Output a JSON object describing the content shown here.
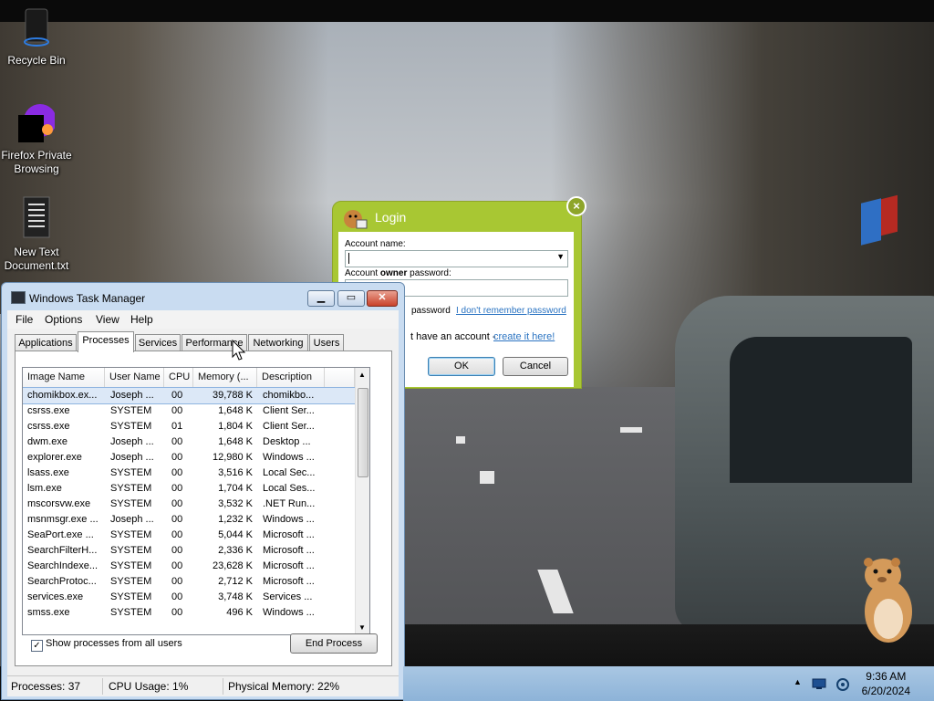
{
  "desktop": {
    "icons": [
      {
        "label": "Recycle Bin",
        "icon": "recycle-bin-icon"
      },
      {
        "label": "Firefox Private Browsing",
        "icon": "firefox-private-icon"
      },
      {
        "label": "New Text Document.txt",
        "icon": "text-document-icon"
      }
    ]
  },
  "login": {
    "title": "Login",
    "account_name_label": "Account name:",
    "account_name_value": "",
    "password_label_pre": "Account ",
    "password_label_bold": "owner",
    "password_label_post": " password:",
    "password_value": "",
    "remember_partial": "password",
    "forgot_link": "I don't remember password",
    "no_account_text": "t have an account - ",
    "create_link": "create it here!",
    "ok_label": "OK",
    "cancel_label": "Cancel"
  },
  "task_manager": {
    "title": "Windows Task Manager",
    "menu": [
      "File",
      "Options",
      "View",
      "Help"
    ],
    "tabs": [
      "Applications",
      "Processes",
      "Services",
      "Performance",
      "Networking",
      "Users"
    ],
    "active_tab": "Processes",
    "columns": [
      "Image Name",
      "User Name",
      "CPU",
      "Memory (...",
      "Description"
    ],
    "processes": [
      {
        "name": "chomikbox.ex...",
        "user": "Joseph ...",
        "cpu": "00",
        "mem": "39,788 K",
        "desc": "chomikbo..."
      },
      {
        "name": "csrss.exe",
        "user": "SYSTEM",
        "cpu": "00",
        "mem": "1,648 K",
        "desc": "Client Ser..."
      },
      {
        "name": "csrss.exe",
        "user": "SYSTEM",
        "cpu": "01",
        "mem": "1,804 K",
        "desc": "Client Ser..."
      },
      {
        "name": "dwm.exe",
        "user": "Joseph ...",
        "cpu": "00",
        "mem": "1,648 K",
        "desc": "Desktop ..."
      },
      {
        "name": "explorer.exe",
        "user": "Joseph ...",
        "cpu": "00",
        "mem": "12,980 K",
        "desc": "Windows ..."
      },
      {
        "name": "lsass.exe",
        "user": "SYSTEM",
        "cpu": "00",
        "mem": "3,516 K",
        "desc": "Local Sec..."
      },
      {
        "name": "lsm.exe",
        "user": "SYSTEM",
        "cpu": "00",
        "mem": "1,704 K",
        "desc": "Local Ses..."
      },
      {
        "name": "mscorsvw.exe",
        "user": "SYSTEM",
        "cpu": "00",
        "mem": "3,532 K",
        "desc": ".NET Run..."
      },
      {
        "name": "msnmsgr.exe ...",
        "user": "Joseph ...",
        "cpu": "00",
        "mem": "1,232 K",
        "desc": "Windows ..."
      },
      {
        "name": "SeaPort.exe ...",
        "user": "SYSTEM",
        "cpu": "00",
        "mem": "5,044 K",
        "desc": "Microsoft ..."
      },
      {
        "name": "SearchFilterH...",
        "user": "SYSTEM",
        "cpu": "00",
        "mem": "2,336 K",
        "desc": "Microsoft ..."
      },
      {
        "name": "SearchIndexe...",
        "user": "SYSTEM",
        "cpu": "00",
        "mem": "23,628 K",
        "desc": "Microsoft ..."
      },
      {
        "name": "SearchProtoc...",
        "user": "SYSTEM",
        "cpu": "00",
        "mem": "2,712 K",
        "desc": "Microsoft ..."
      },
      {
        "name": "services.exe",
        "user": "SYSTEM",
        "cpu": "00",
        "mem": "3,748 K",
        "desc": "Services ..."
      },
      {
        "name": "smss.exe",
        "user": "SYSTEM",
        "cpu": "00",
        "mem": "496 K",
        "desc": "Windows ..."
      }
    ],
    "show_all_label": "Show processes from all users",
    "show_all_checked": true,
    "end_process_label": "End Process",
    "status": {
      "processes": "Processes: 37",
      "cpu": "CPU Usage: 1%",
      "memory": "Physical Memory: 22%"
    }
  },
  "taskbar": {
    "time": "9:36 AM",
    "date": "6/20/2024"
  }
}
